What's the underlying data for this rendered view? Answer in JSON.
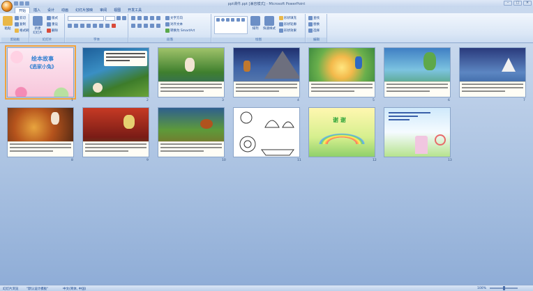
{
  "window": {
    "title": "ppt课件.ppt [兼容模式] - Microsoft PowerPoint",
    "minimize": "–",
    "maximize": "□",
    "close": "×"
  },
  "tabs": [
    "开始",
    "插入",
    "设计",
    "动画",
    "幻灯片放映",
    "审阅",
    "视图",
    "开发工具"
  ],
  "ribbon": {
    "clipboard": {
      "label": "剪贴板",
      "paste": "粘贴",
      "cut": "剪切",
      "copy": "复制",
      "format_painter": "格式刷"
    },
    "slides": {
      "label": "幻灯片",
      "new_slide": "新建\n幻灯片",
      "layout": "版式",
      "reset": "重设",
      "delete": "删除"
    },
    "font": {
      "label": "字体"
    },
    "paragraph": {
      "label": "段落",
      "text_direction": "文字方向",
      "align_text": "对齐文本",
      "smartart": "转换为 SmartArt"
    },
    "drawing": {
      "label": "绘图",
      "arrange": "排列",
      "quick_styles": "快速样式",
      "shape_fill": "形状填充",
      "shape_outline": "形状轮廓",
      "shape_effects": "形状效果"
    },
    "editing": {
      "label": "编辑",
      "find": "查找",
      "replace": "替换",
      "select": "选择"
    }
  },
  "slides": [
    {
      "num": "1",
      "title": "绘本故事",
      "subtitle": "《逃家小兔》"
    },
    {
      "num": "2"
    },
    {
      "num": "3"
    },
    {
      "num": "4"
    },
    {
      "num": "5"
    },
    {
      "num": "6"
    },
    {
      "num": "7"
    },
    {
      "num": "8"
    },
    {
      "num": "9"
    },
    {
      "num": "10"
    },
    {
      "num": "11"
    },
    {
      "num": "12",
      "title": "谢 谢"
    },
    {
      "num": "13"
    }
  ],
  "statusbar": {
    "slide_sorter": "幻灯片浏览",
    "theme": "\"默认设计模板\"",
    "language": "中文(简体, 中国)",
    "zoom": "100%"
  },
  "colors": {
    "accent": "#15428b",
    "selection": "#f2a23c"
  }
}
